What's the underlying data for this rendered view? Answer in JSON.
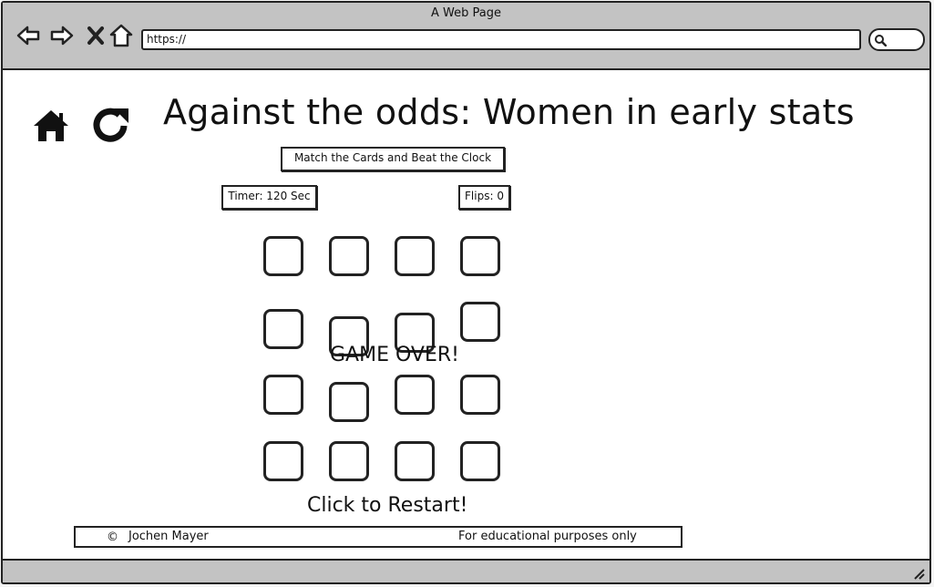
{
  "browser": {
    "title": "A Web Page",
    "url": "https://",
    "icons": [
      "back-icon",
      "forward-icon",
      "stop-icon",
      "home-icon",
      "search-icon"
    ]
  },
  "toolbar": {
    "home_icon": "home-icon",
    "refresh_icon": "refresh-icon"
  },
  "page": {
    "title": "Against the odds: Women in early stats",
    "subtitle": "Match the Cards and Beat the Clock",
    "timer": "Timer: 120 Sec",
    "flips": "Flips: 0",
    "game_over": "GAME OVER!",
    "restart": "Click to Restart!"
  },
  "board": {
    "rows": 4,
    "cols": 4,
    "cards": 16
  },
  "footer": {
    "copyright_symbol": "©",
    "author": "Jochen Mayer",
    "note": "For educational purposes only"
  }
}
